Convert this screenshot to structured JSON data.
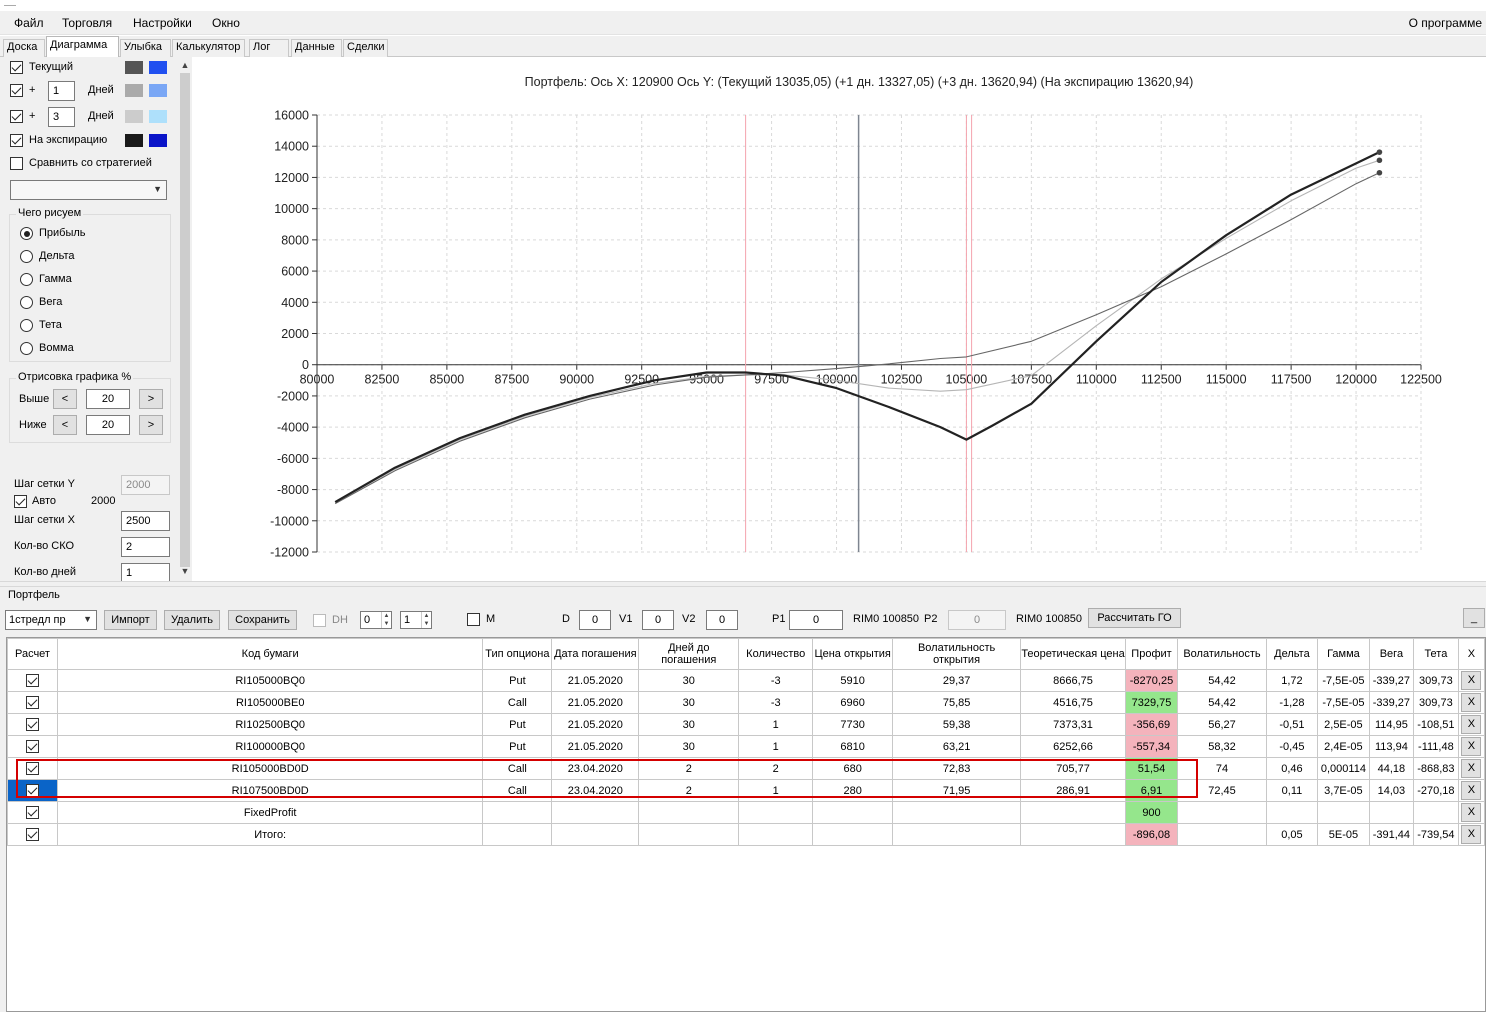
{
  "menu": {
    "items": [
      "Файл",
      "Торговля",
      "Настройки",
      "Окно"
    ],
    "about": "О программе"
  },
  "tabs": [
    "Доска",
    "Диаграмма",
    "Улыбка",
    "Калькулятор",
    "Лог",
    "Данные",
    "Сделки"
  ],
  "active_tab": "Диаграмма",
  "left": {
    "current_label": "Текущий",
    "plus1_sign": "+",
    "plus1_value": "1",
    "days_label": "Дней",
    "plus3_sign": "+",
    "plus3_value": "3",
    "expiry_label": "На экспирацию",
    "compare_label": "Сравнить со стратегией",
    "draw_group": "Чего рисуем",
    "draw_options": [
      "Прибыль",
      "Дельта",
      "Гамма",
      "Вега",
      "Тета",
      "Вомма"
    ],
    "render_group": "Отрисовка графика %",
    "above_label": "Выше",
    "above_value": "20",
    "below_label": "Ниже",
    "below_value": "20",
    "prev_glyph": "<",
    "next_glyph": ">",
    "grid_y_label": "Шаг сетки Y",
    "grid_y_value": "2000",
    "auto_label": "Авто",
    "auto_value": "2000",
    "grid_x_label": "Шаг сетки X",
    "grid_x_value": "2500",
    "sko_label": "Кол-во СКО",
    "sko_value": "2",
    "days_count_label": "Кол-во дней",
    "days_count_value": "1",
    "colors": {
      "current": [
        "#555555",
        "#2050f0"
      ],
      "plus1": [
        "#aaaaaa",
        "#7aa7f5"
      ],
      "plus3": [
        "#cccccc",
        "#aee0fb"
      ],
      "expiry": [
        "#1a1a1a",
        "#0a14c8"
      ]
    }
  },
  "chart_data": {
    "type": "line",
    "title": "Портфель: Ось X:  120900 Ось Y:   (Текущий 13035,05)  (+1 дн. 13327,05)  (+3 дн.  13620,94)  (На экспирацию 13620,94)",
    "xlim": [
      80000,
      122500
    ],
    "ylim": [
      -12000,
      16000
    ],
    "x_ticks": [
      "80000",
      "82500",
      "85000",
      "87500",
      "90000",
      "92500",
      "95000",
      "97500",
      "100000",
      "102500",
      "105000",
      "107500",
      "110000",
      "112500",
      "115000",
      "117500",
      "120000",
      "122500"
    ],
    "y_ticks": [
      "16000",
      "14000",
      "12000",
      "10000",
      "8000",
      "6000",
      "4000",
      "2000",
      "0",
      "-2000",
      "-4000",
      "-6000",
      "-8000",
      "-10000",
      "-12000"
    ],
    "grid": true,
    "vlines": [
      {
        "x": 96500,
        "color": "#f4a3ad"
      },
      {
        "x": 100850,
        "color": "#7e8590"
      },
      {
        "x": 105000,
        "color": "#f4a3ad"
      },
      {
        "x": 105200,
        "color": "#f4a3ad"
      }
    ],
    "series": [
      {
        "color": "#222222",
        "x": [
          80700,
          83000,
          85500,
          88000,
          90500,
          93000,
          95000,
          96500,
          98000,
          100000,
          102000,
          104000,
          105000,
          106000,
          107500,
          110000,
          112500,
          115000,
          117500,
          120000,
          120900
        ],
        "y": [
          -8800,
          -6600,
          -4700,
          -3200,
          -2000,
          -1000,
          -500,
          -500,
          -700,
          -1500,
          -2700,
          -4000,
          -4800,
          -3900,
          -2500,
          1500,
          5300,
          8300,
          10900,
          12900,
          13620
        ]
      },
      {
        "color": "#666666",
        "x": [
          80700,
          83000,
          85500,
          88000,
          90500,
          93000,
          95000,
          96500,
          98000,
          100000,
          102000,
          104000,
          105000,
          107500,
          110000,
          112500,
          115000,
          117500,
          120000,
          120900
        ],
        "y": [
          -8900,
          -6800,
          -4900,
          -3400,
          -2200,
          -1300,
          -800,
          -650,
          -500,
          -250,
          50,
          400,
          500,
          1500,
          3200,
          5000,
          7100,
          9300,
          11600,
          12300
        ]
      },
      {
        "color": "#b5b5b5",
        "x": [
          80700,
          83000,
          85500,
          88000,
          90500,
          93000,
          95000,
          96500,
          98000,
          100000,
          102000,
          104000,
          105000,
          107500,
          110000,
          112500,
          115000,
          117500,
          120000,
          120900
        ],
        "y": [
          -8800,
          -6700,
          -4800,
          -3300,
          -2100,
          -1200,
          -750,
          -650,
          -650,
          -1000,
          -1500,
          -1700,
          -1600,
          -700,
          2500,
          5500,
          8100,
          10500,
          12600,
          13100
        ]
      }
    ]
  },
  "portfolio": {
    "title": "Портфель",
    "strategy": "1стредл пр",
    "buttons": {
      "import": "Импорт",
      "delete": "Удалить",
      "save": "Сохранить",
      "calc_go": "Рассчитать ГО",
      "minimize": "_"
    },
    "dh_label": "DH",
    "dh_spin1": "0",
    "dh_spin2": "1",
    "m_label": "M",
    "d_label": "D",
    "d_value": "0",
    "v1_label": "V1",
    "v1_value": "0",
    "v2_label": "V2",
    "v2_value": "0",
    "p1_label": "P1",
    "p1_value": "0",
    "p1_ticker": "RIM0 100850",
    "p2_label": "P2",
    "p2_value": "0",
    "p2_ticker": "RIM0 100850"
  },
  "table": {
    "headers": [
      "Расчет",
      "Код бумаги",
      "Тип опциона",
      "Дата погашения",
      "Дней до погашения",
      "Количество",
      "Цена открытия",
      "Волатильность открытия",
      "Теоретическая цена",
      "Профит",
      "Волатильность",
      "Дельта",
      "Гамма",
      "Вега",
      "Тета",
      "X"
    ],
    "rows": [
      {
        "cells": [
          "RI105000BQ0",
          "Put",
          "21.05.2020",
          "30",
          "-3",
          "5910",
          "29,37",
          "8666,75",
          "-8270,25",
          "54,42",
          "1,72",
          "-7,5E-05",
          "-339,27",
          "309,73"
        ],
        "profit": "red"
      },
      {
        "cells": [
          "RI105000BE0",
          "Call",
          "21.05.2020",
          "30",
          "-3",
          "6960",
          "75,85",
          "4516,75",
          "7329,75",
          "54,42",
          "-1,28",
          "-7,5E-05",
          "-339,27",
          "309,73"
        ],
        "profit": "green"
      },
      {
        "cells": [
          "RI102500BQ0",
          "Put",
          "21.05.2020",
          "30",
          "1",
          "7730",
          "59,38",
          "7373,31",
          "-356,69",
          "56,27",
          "-0,51",
          "2,5E-05",
          "114,95",
          "-108,51"
        ],
        "profit": "red"
      },
      {
        "cells": [
          "RI100000BQ0",
          "Put",
          "21.05.2020",
          "30",
          "1",
          "6810",
          "63,21",
          "6252,66",
          "-557,34",
          "58,32",
          "-0,45",
          "2,4E-05",
          "113,94",
          "-111,48"
        ],
        "profit": "red"
      },
      {
        "cells": [
          "RI105000BD0D",
          "Call",
          "23.04.2020",
          "2",
          "2",
          "680",
          "72,83",
          "705,77",
          "51,54",
          "74",
          "0,46",
          "0,000114",
          "44,18",
          "-868,83"
        ],
        "profit": "green"
      },
      {
        "cells": [
          "RI107500BD0D",
          "Call",
          "23.04.2020",
          "2",
          "1",
          "280",
          "71,95",
          "286,91",
          "6,91",
          "72,45",
          "0,11",
          "3,7E-05",
          "14,03",
          "-270,18"
        ],
        "profit": "green",
        "selected": true
      },
      {
        "cells": [
          "FixedProfit",
          "",
          "",
          "",
          "",
          "",
          "",
          "",
          "900",
          "",
          "",
          "",
          "",
          ""
        ],
        "profit": "green"
      },
      {
        "cells": [
          "Итого:",
          "",
          "",
          "",
          "",
          "",
          "",
          "",
          "-896,08",
          "",
          "0,05",
          "5E-05",
          "-391,44",
          "-739,54"
        ],
        "profit": "red"
      }
    ],
    "x_label": "X"
  }
}
